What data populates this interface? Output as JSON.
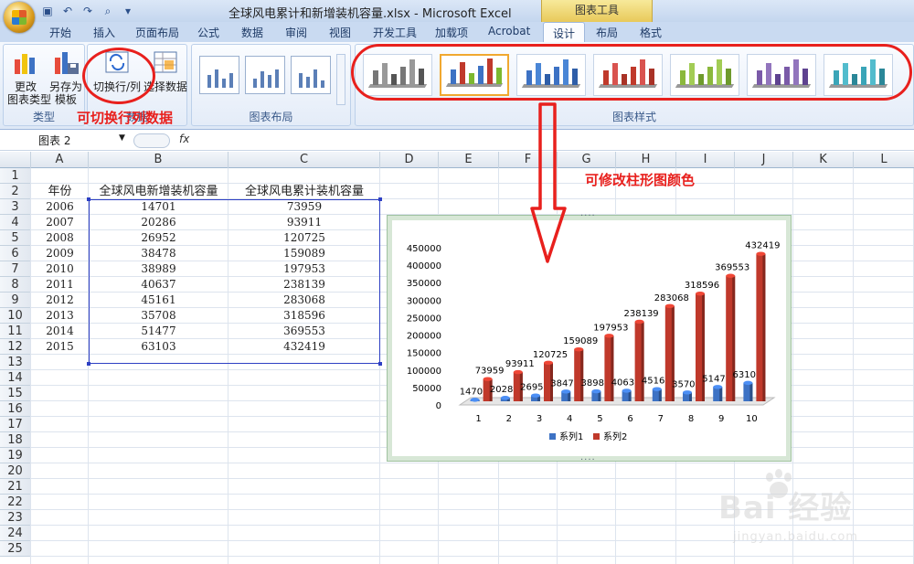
{
  "window": {
    "title": "全球风电累计和新增装机容量.xlsx - Microsoft Excel",
    "chart_tools": "图表工具"
  },
  "tabs": [
    "开始",
    "插入",
    "页面布局",
    "公式",
    "数据",
    "审阅",
    "视图",
    "开发工具",
    "加载项",
    "Acrobat",
    "设计",
    "布局",
    "格式"
  ],
  "active_tab": "设计",
  "ribbon": {
    "group_type": {
      "label": "类型",
      "change_type": "更改\n图表类型",
      "save_template": "另存为\n模板"
    },
    "group_data": {
      "label": "数据",
      "switch_row_col": "切换行/列",
      "select_data": "选择数据"
    },
    "group_layout": {
      "label": "图表布局"
    },
    "group_styles": {
      "label": "图表样式"
    }
  },
  "annotations": {
    "switch_note": "可切换行列数据",
    "color_note": "可修改柱形图颜色"
  },
  "formula_bar": {
    "name_box": "图表  2",
    "fx": "fx"
  },
  "columns": [
    "A",
    "B",
    "C",
    "D",
    "E",
    "F",
    "G",
    "H",
    "I",
    "J",
    "K",
    "L"
  ],
  "rows": [
    "1",
    "2",
    "3",
    "4",
    "5",
    "6",
    "7",
    "8",
    "9",
    "10",
    "11",
    "12",
    "13",
    "14",
    "15",
    "16",
    "17",
    "18",
    "19",
    "20",
    "21",
    "22",
    "23",
    "24",
    "25"
  ],
  "sheet": {
    "headers": [
      "年份",
      "全球风电新增装机容量",
      "全球风电累计装机容量"
    ],
    "data": [
      [
        "2006",
        "14701",
        "73959"
      ],
      [
        "2007",
        "20286",
        "93911"
      ],
      [
        "2008",
        "26952",
        "120725"
      ],
      [
        "2009",
        "38478",
        "159089"
      ],
      [
        "2010",
        "38989",
        "197953"
      ],
      [
        "2011",
        "40637",
        "238139"
      ],
      [
        "2012",
        "45161",
        "283068"
      ],
      [
        "2013",
        "35708",
        "318596"
      ],
      [
        "2014",
        "51477",
        "369553"
      ],
      [
        "2015",
        "63103",
        "432419"
      ]
    ]
  },
  "chart_data": {
    "type": "bar",
    "categories": [
      "1",
      "2",
      "3",
      "4",
      "5",
      "6",
      "7",
      "8",
      "9",
      "10"
    ],
    "series": [
      {
        "name": "系列1",
        "values": [
          14701,
          20286,
          26952,
          38478,
          38989,
          40637,
          45161,
          35708,
          51477,
          63103
        ],
        "color": "#3d72c4"
      },
      {
        "name": "系列2",
        "values": [
          73959,
          93911,
          120725,
          159089,
          197953,
          238139,
          283068,
          318596,
          369553,
          432419
        ],
        "color": "#c0392b"
      }
    ],
    "yticks": [
      "0",
      "50000",
      "100000",
      "150000",
      "200000",
      "250000",
      "300000",
      "350000",
      "400000",
      "450000"
    ],
    "ylim": [
      0,
      450000
    ],
    "legend": "bottom",
    "grid": false
  },
  "watermark": {
    "brand": "Bai 经验",
    "url": "jingyan.baidu.com"
  }
}
